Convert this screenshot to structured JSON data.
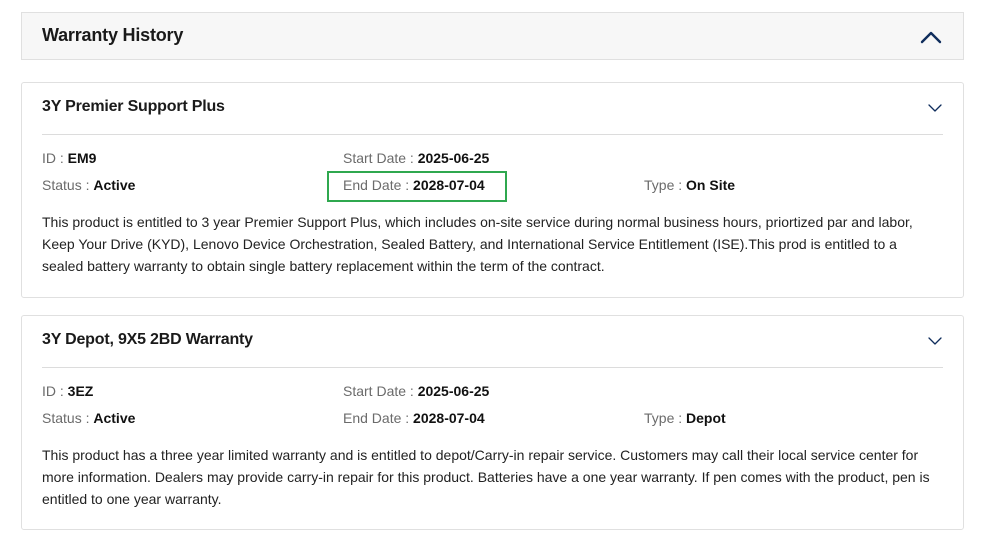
{
  "section": {
    "title": "Warranty History",
    "collapse_icon": "chevron-up-icon"
  },
  "separator": ":",
  "cards": [
    {
      "title": "3Y Premier Support Plus",
      "expand_icon": "chevron-down-icon",
      "id_label": "ID",
      "id_value": "EM9",
      "start_label": "Start Date",
      "start_value": "2025-06-25",
      "status_label": "Status",
      "status_value": "Active",
      "end_label": "End Date",
      "end_value": "2028-07-04",
      "type_label": "Type",
      "type_value": "On Site",
      "description": "This product is entitled to 3 year Premier Support Plus, which includes on-site service during normal business hours, priortized par and labor, Keep Your Drive (KYD), Lenovo Device Orchestration, Sealed Battery, and International Service Entitlement (ISE).This prod is entitled to a sealed battery warranty to obtain single battery replacement within the term of the contract."
    },
    {
      "title": "3Y Depot, 9X5 2BD Warranty",
      "expand_icon": "chevron-down-icon",
      "id_label": "ID",
      "id_value": "3EZ",
      "start_label": "Start Date",
      "start_value": "2025-06-25",
      "status_label": "Status",
      "status_value": "Active",
      "end_label": "End Date",
      "end_value": "2028-07-04",
      "type_label": "Type",
      "type_value": "Depot",
      "description": "This product has a three year limited warranty and is entitled to depot/Carry-in repair service. Customers may call their local service center for more information. Dealers may provide carry-in repair for this product. Batteries have a one year warranty. If pen comes with the product, pen is entitled to one year warranty."
    }
  ],
  "colors": {
    "highlight_border": "#2fa84f",
    "chevron": "#0f2d5c",
    "header_bg": "#f7f7f7"
  }
}
